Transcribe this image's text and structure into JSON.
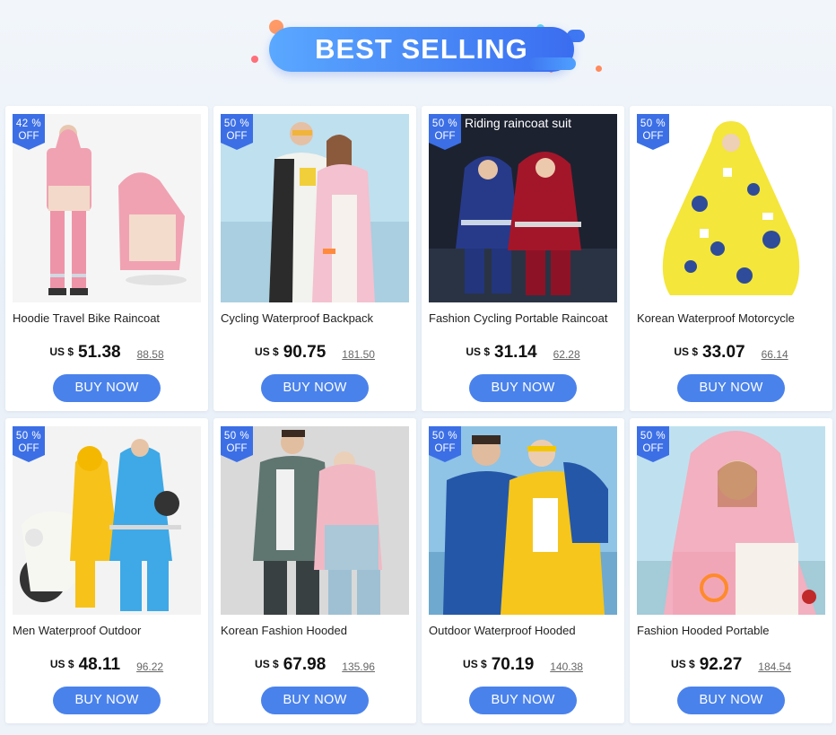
{
  "banner": {
    "title": "BEST SELLING",
    "colors": {
      "accent": "#3c6fe6",
      "pill_start": "#5aa8ff",
      "dot_orange": "#ff8a5c",
      "dot_cyan": "#5fd3e8"
    }
  },
  "products": [
    {
      "badge_pct": "42 %",
      "badge_off": "OFF",
      "title": "Hoodie Travel Bike Raincoat",
      "currency": "US $",
      "price": "51.38",
      "old_price": "88.58",
      "button": "BUY NOW",
      "photo_icon": "pink-raincoat-photo"
    },
    {
      "badge_pct": "50 %",
      "badge_off": "OFF",
      "title": "Cycling Waterproof Backpack",
      "currency": "US $",
      "price": "90.75",
      "old_price": "181.50",
      "button": "BUY NOW",
      "photo_icon": "couple-raincoat-photo"
    },
    {
      "badge_pct": "50 %",
      "badge_off": "OFF",
      "title": "Fashion Cycling Portable Raincoat",
      "currency": "US $",
      "price": "31.14",
      "old_price": "62.28",
      "button": "BUY NOW",
      "photo_icon": "riding-raincoat-suit-photo",
      "photo_caption": "Riding raincoat suit"
    },
    {
      "badge_pct": "50 %",
      "badge_off": "OFF",
      "title": "Korean Waterproof Motorcycle",
      "currency": "US $",
      "price": "33.07",
      "old_price": "66.14",
      "button": "BUY NOW",
      "photo_icon": "yellow-poncho-photo"
    },
    {
      "badge_pct": "50 %",
      "badge_off": "OFF",
      "title": "Men Waterproof Outdoor",
      "currency": "US $",
      "price": "48.11",
      "old_price": "96.22",
      "button": "BUY NOW",
      "photo_icon": "scooter-raincoat-photo"
    },
    {
      "badge_pct": "50 %",
      "badge_off": "OFF",
      "title": "Korean Fashion Hooded",
      "currency": "US $",
      "price": "67.98",
      "old_price": "135.96",
      "button": "BUY NOW",
      "photo_icon": "hooded-couple-photo"
    },
    {
      "badge_pct": "50 %",
      "badge_off": "OFF",
      "title": "Outdoor Waterproof Hooded",
      "currency": "US $",
      "price": "70.19",
      "old_price": "140.38",
      "button": "BUY NOW",
      "photo_icon": "blue-yellow-jacket-photo"
    },
    {
      "badge_pct": "50 %",
      "badge_off": "OFF",
      "title": "Fashion Hooded Portable",
      "currency": "US $",
      "price": "92.27",
      "old_price": "184.54",
      "button": "BUY NOW",
      "photo_icon": "pink-hood-photo"
    }
  ]
}
